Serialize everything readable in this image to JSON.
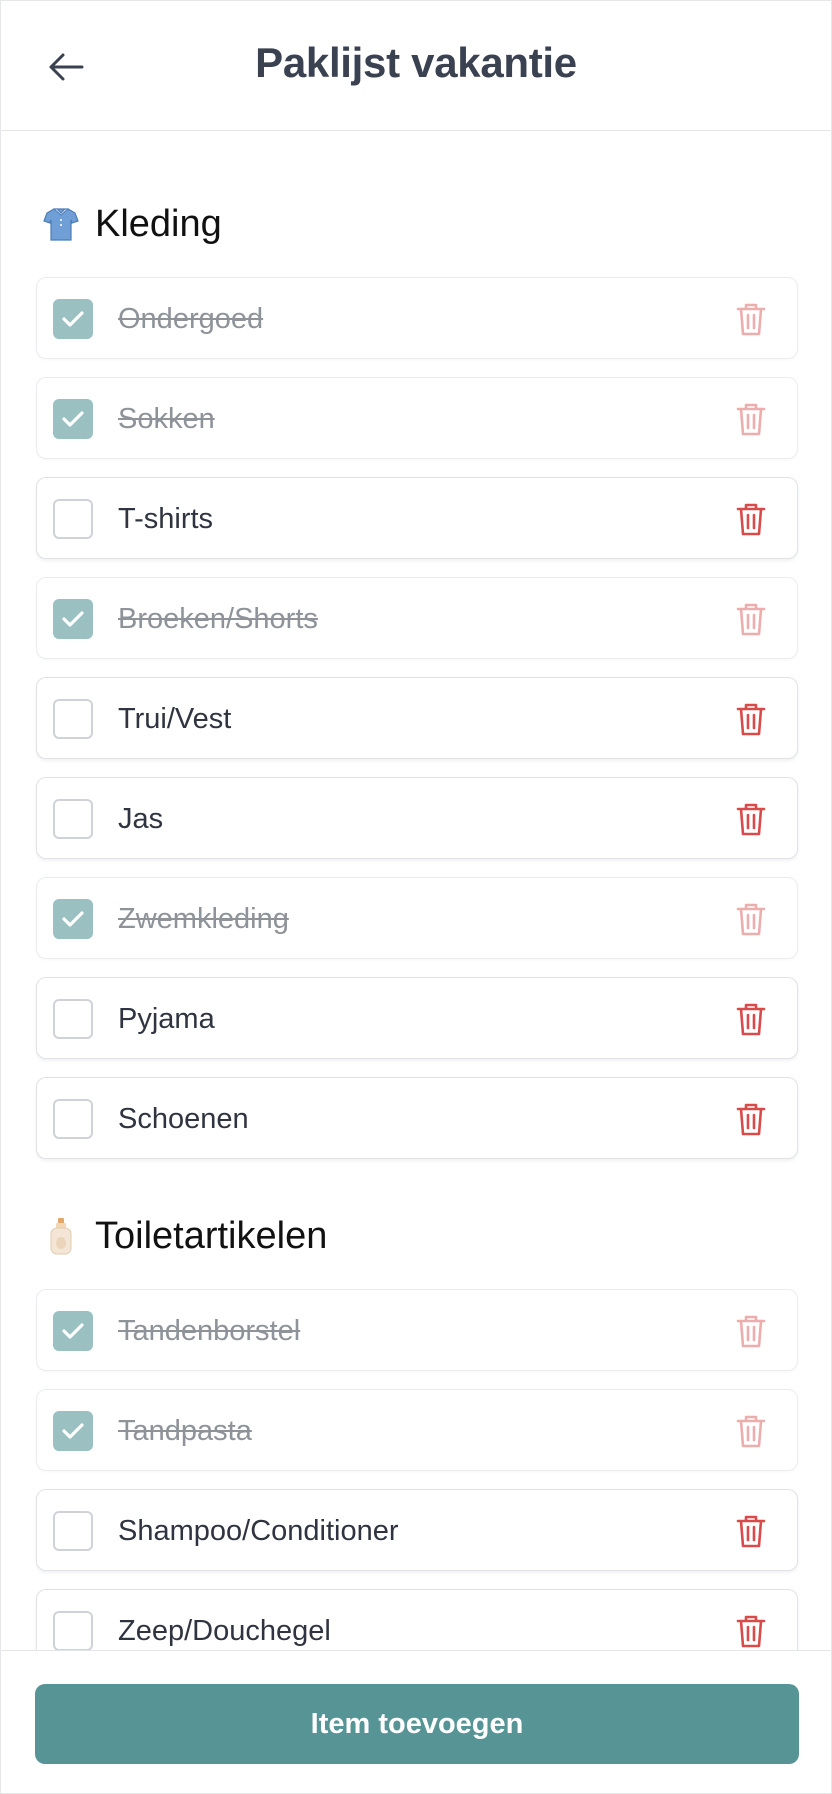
{
  "header": {
    "title": "Paklijst vakantie",
    "back_icon": "arrow-left-icon"
  },
  "colors": {
    "accent": "#579496",
    "checked": "#9ac0c2",
    "delete": "#d94b4b"
  },
  "sections": [
    {
      "title": "Kleding",
      "emoji": "shirt-emoji",
      "items": [
        {
          "label": "Ondergoed",
          "checked": true
        },
        {
          "label": "Sokken",
          "checked": true
        },
        {
          "label": "T-shirts",
          "checked": false
        },
        {
          "label": "Broeken/Shorts",
          "checked": true
        },
        {
          "label": "Trui/Vest",
          "checked": false
        },
        {
          "label": "Jas",
          "checked": false
        },
        {
          "label": "Zwemkleding",
          "checked": true
        },
        {
          "label": "Pyjama",
          "checked": false
        },
        {
          "label": "Schoenen",
          "checked": false
        }
      ]
    },
    {
      "title": "Toiletartikelen",
      "emoji": "lotion-bottle-emoji",
      "items": [
        {
          "label": "Tandenborstel",
          "checked": true
        },
        {
          "label": "Tandpasta",
          "checked": true
        },
        {
          "label": "Shampoo/Conditioner",
          "checked": false
        },
        {
          "label": "Zeep/Douchegel",
          "checked": false
        }
      ]
    }
  ],
  "footer": {
    "add_label": "Item toevoegen"
  }
}
